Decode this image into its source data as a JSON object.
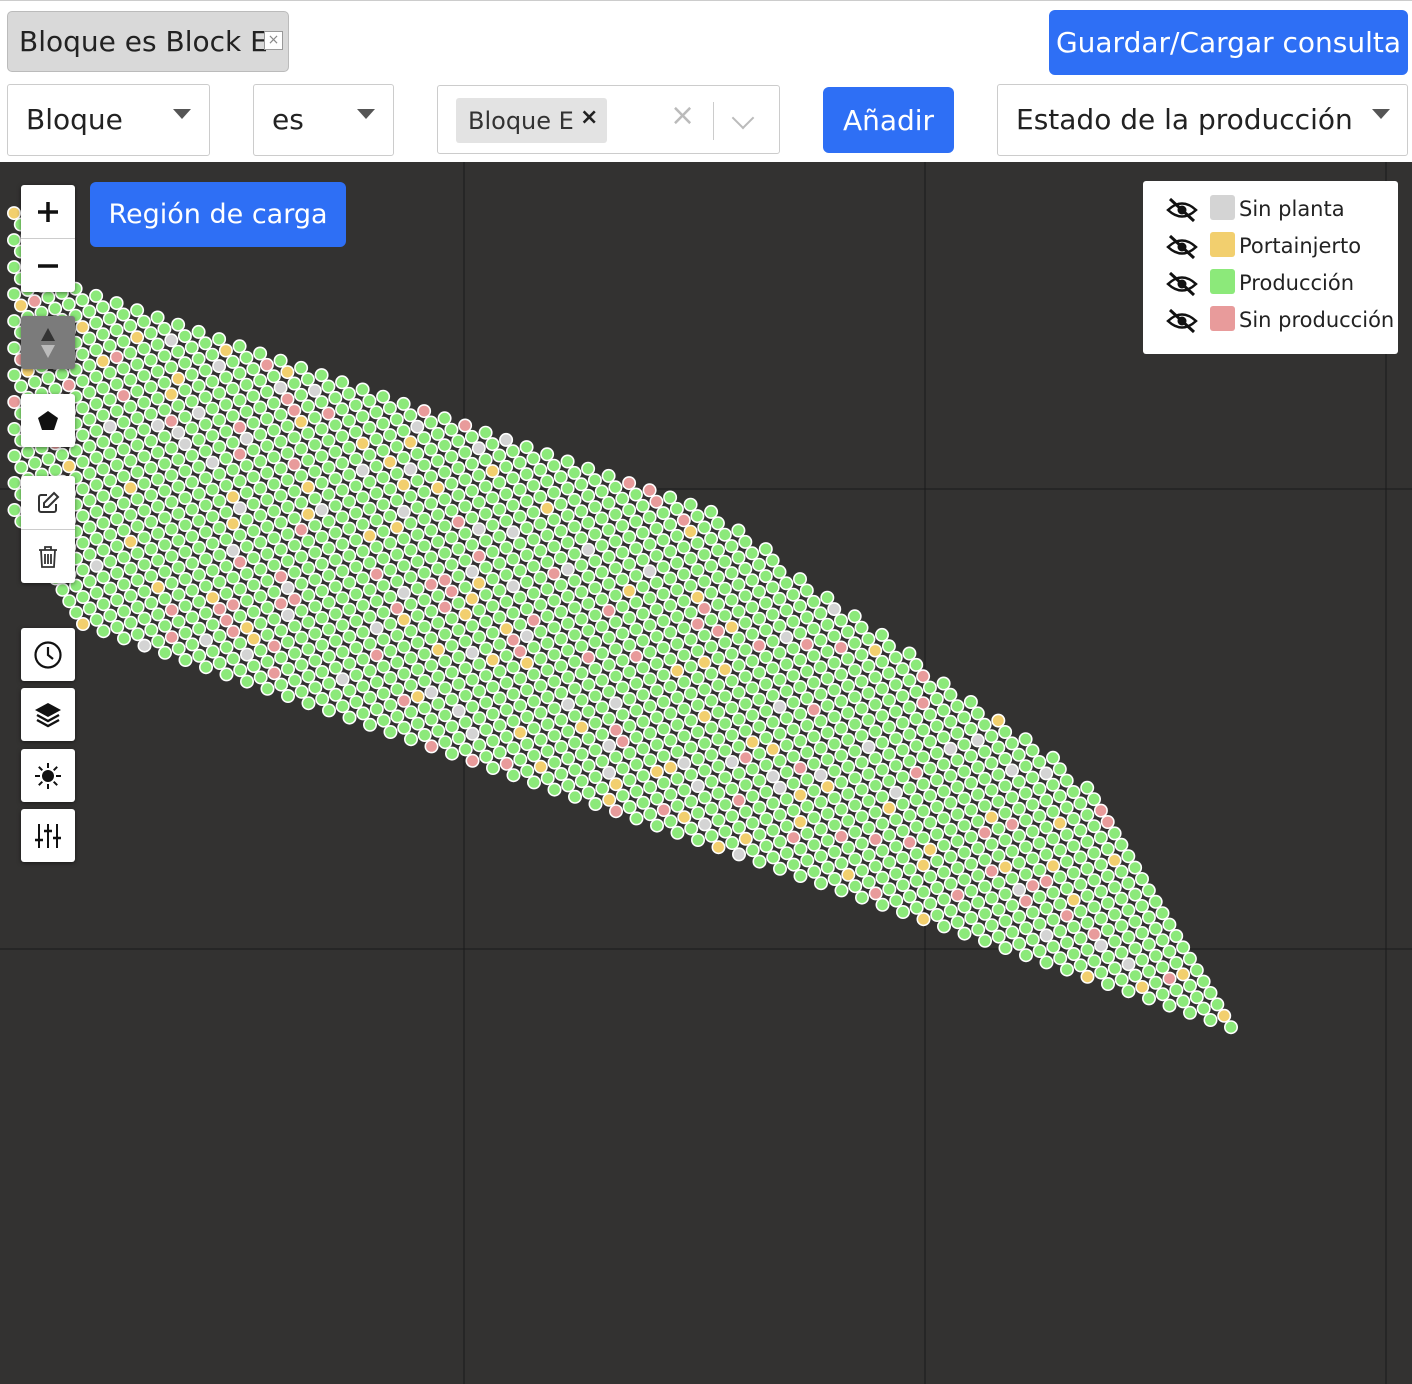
{
  "filter_chip": {
    "label": "Bloque es Block E",
    "remove": "×"
  },
  "buttons": {
    "save_load": "Guardar/Cargar consulta",
    "add": "Añadir",
    "region": "Región de carga"
  },
  "filter_row": {
    "field": "Bloque",
    "operator": "es",
    "value_tag": "Bloque E",
    "value_tag_remove": "×",
    "clear": "×",
    "attribute": "Estado de la producción"
  },
  "legend": {
    "items": [
      {
        "label": "Sin planta",
        "color": "#d4d4d4"
      },
      {
        "label": "Portainjerto",
        "color": "#f2cf6e"
      },
      {
        "label": "Producción",
        "color": "#8ce97a"
      },
      {
        "label": "Sin producción",
        "color": "#e89b9b"
      }
    ]
  },
  "map_controls": [
    "zoom-in",
    "zoom-out",
    "compass",
    "draw-polygon",
    "edit",
    "delete",
    "history",
    "layers",
    "brightness",
    "adjustments"
  ],
  "colors": {
    "accent": "#2e6ff5",
    "map_bg": "#333231"
  }
}
